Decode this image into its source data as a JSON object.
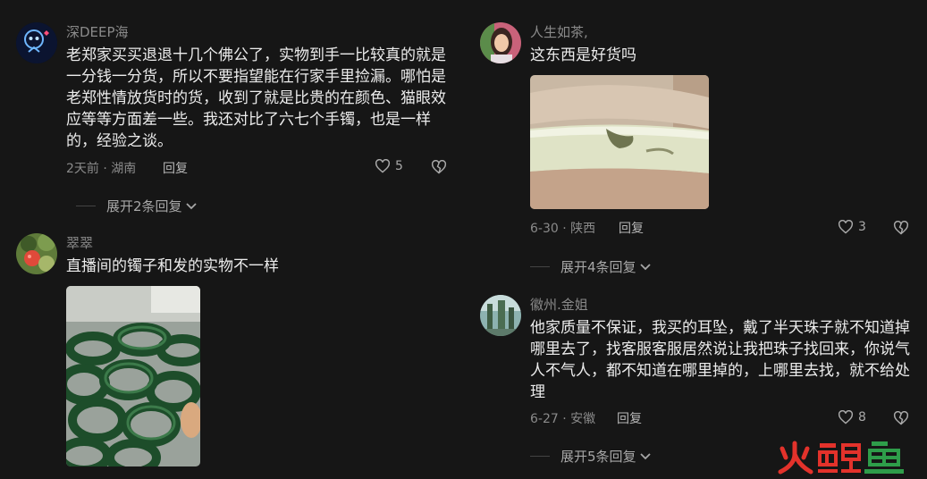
{
  "comments_left": [
    {
      "username": "深DEEP海",
      "text": "老郑家买买退退十几个佛公了，实物到手一比较真的就是一分钱一分货，所以不要指望能在行家手里捡漏。哪怕是老郑性情放货时的货，收到了就是比贵的在颜色、猫眼效应等等方面差一些。我还对比了六七个手镯，也是一样的，经验之谈。",
      "meta": "2天前 · 湖南",
      "reply_label": "回复",
      "likes": "5",
      "expand_label": "展开2条回复"
    },
    {
      "username": "翠翠",
      "text": "直播间的镯子和发的实物不一样"
    }
  ],
  "comments_right": [
    {
      "username": "人生如茶,",
      "text": "这东西是好货吗",
      "meta": "6-30 · 陕西",
      "reply_label": "回复",
      "likes": "3",
      "expand_label": "展开4条回复"
    },
    {
      "username": "徽州.金姐",
      "text": "他家质量不保证，我买的耳坠，戴了半天珠子就不知道掉哪里去了，找客服客服居然说让我把珠子找回来，你说气人不气人，都不知道在哪里掉的，上哪里去找，就不给处理",
      "meta": "6-27 · 安徽",
      "reply_label": "回复",
      "likes": "8",
      "expand_label": "展开5条回复"
    }
  ],
  "watermark": "火鲤鱼",
  "colors": {
    "background": "#161616",
    "text": "#ececec",
    "meta": "#8a8a8a",
    "watermark_red": "#e3322b",
    "watermark_green": "#2e9d4a"
  }
}
